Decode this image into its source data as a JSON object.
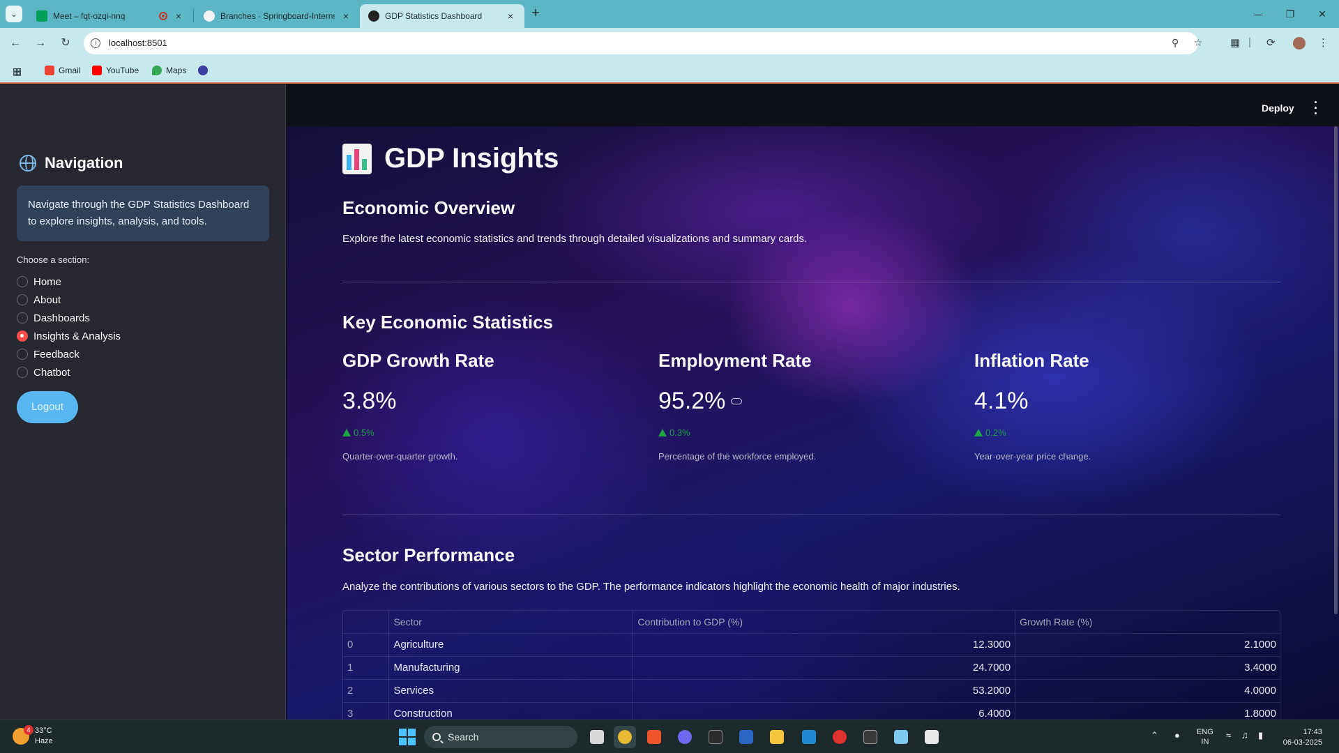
{
  "browser": {
    "tabs": [
      {
        "title": "Meet – fqt-ozqi-nnq",
        "active": false
      },
      {
        "title": "Branches · Springboard-Internshi",
        "active": false
      },
      {
        "title": "GDP Statistics Dashboard",
        "active": true
      }
    ],
    "url": "localhost:8501",
    "bookmarks": [
      "Gmail",
      "YouTube",
      "Maps"
    ]
  },
  "sidebar": {
    "title": "Navigation",
    "info": "Navigate through the GDP Statistics Dashboard to explore insights, analysis, and tools.",
    "choose_label": "Choose a section:",
    "options": [
      {
        "label": "Home",
        "selected": false
      },
      {
        "label": "About",
        "selected": false
      },
      {
        "label": "Dashboards",
        "selected": false
      },
      {
        "label": "Insights & Analysis",
        "selected": true
      },
      {
        "label": "Feedback",
        "selected": false
      },
      {
        "label": "Chatbot",
        "selected": false
      }
    ],
    "logout_label": "Logout"
  },
  "header": {
    "deploy_label": "Deploy"
  },
  "main": {
    "title": "GDP Insights",
    "overview_heading": "Economic Overview",
    "overview_text": "Explore the latest economic statistics and trends through detailed visualizations and summary cards.",
    "stats_heading": "Key Economic Statistics",
    "metrics": [
      {
        "title": "GDP Growth Rate",
        "value": "3.8%",
        "delta": "0.5%",
        "caption": "Quarter-over-quarter growth."
      },
      {
        "title": "Employment Rate",
        "value": "95.2%",
        "delta": "0.3%",
        "caption": "Percentage of the workforce employed."
      },
      {
        "title": "Inflation Rate",
        "value": "4.1%",
        "delta": "0.2%",
        "caption": "Year-over-year price change."
      }
    ],
    "sector_heading": "Sector Performance",
    "sector_text": "Analyze the contributions of various sectors to the GDP. The performance indicators highlight the economic health of major industries.",
    "table": {
      "columns": [
        "",
        "Sector",
        "Contribution to GDP (%)",
        "Growth Rate (%)"
      ],
      "rows": [
        [
          "0",
          "Agriculture",
          "12.3000",
          "2.1000"
        ],
        [
          "1",
          "Manufacturing",
          "24.7000",
          "3.4000"
        ],
        [
          "2",
          "Services",
          "53.2000",
          "4.0000"
        ],
        [
          "3",
          "Construction",
          "6.4000",
          "1.8000"
        ]
      ]
    }
  },
  "taskbar": {
    "weather_temp": "33°C",
    "weather_desc": "Haze",
    "weather_badge": "4",
    "search_label": "Search",
    "lang_top": "ENG",
    "lang_bottom": "IN",
    "time": "17:43",
    "date": "06-03-2025"
  },
  "colors": {
    "accent_red": "#ff4b4b",
    "logout_blue": "#58b6f0",
    "delta_green": "#1f9d46",
    "sidebar_bg": "#262730"
  }
}
